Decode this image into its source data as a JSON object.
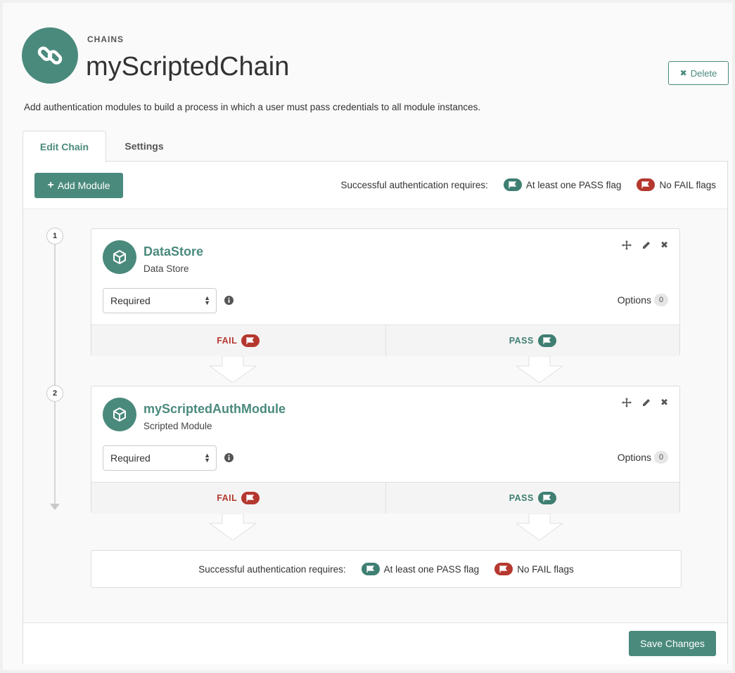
{
  "header": {
    "kicker": "CHAINS",
    "title": "myScriptedChain",
    "delete_label": "Delete",
    "description": "Add authentication modules to build a process in which a user must pass credentials to all module instances."
  },
  "tabs": [
    {
      "label": "Edit Chain",
      "active": true
    },
    {
      "label": "Settings",
      "active": false
    }
  ],
  "toolbar": {
    "add_module_label": "Add Module",
    "requirement_prefix": "Successful authentication requires:",
    "pass_requirement": "At least one PASS flag",
    "fail_requirement": "No FAIL flags"
  },
  "modules": [
    {
      "step": "1",
      "name": "DataStore",
      "type": "Data Store",
      "criteria": "Required",
      "options_label": "Options",
      "options_count": "0",
      "fail_label": "FAIL",
      "pass_label": "PASS"
    },
    {
      "step": "2",
      "name": "myScriptedAuthModule",
      "type": "Scripted Module",
      "criteria": "Required",
      "options_label": "Options",
      "options_count": "0",
      "fail_label": "FAIL",
      "pass_label": "PASS"
    }
  ],
  "summary": {
    "prefix": "Successful authentication requires:",
    "pass_requirement": "At least one PASS flag",
    "fail_requirement": "No FAIL flags"
  },
  "footer": {
    "save_label": "Save Changes"
  },
  "colors": {
    "accent": "#4a8a7c",
    "pass": "#3f7f72",
    "fail": "#b5382f"
  }
}
